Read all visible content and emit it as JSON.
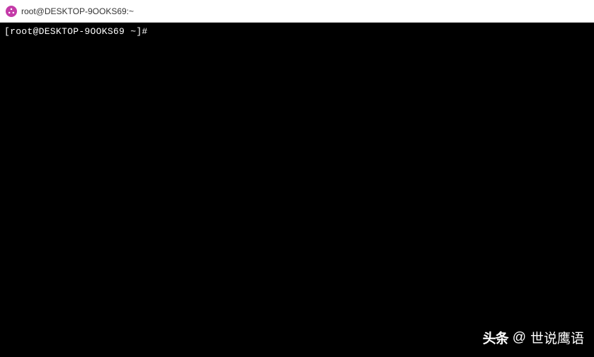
{
  "window": {
    "title": "root@DESKTOP-9OOKS69:~"
  },
  "terminal": {
    "prompt": "[root@DESKTOP-9OOKS69 ~]#"
  },
  "watermark": {
    "logo_text": "头条",
    "at": "@",
    "name": "世说鹰语"
  }
}
